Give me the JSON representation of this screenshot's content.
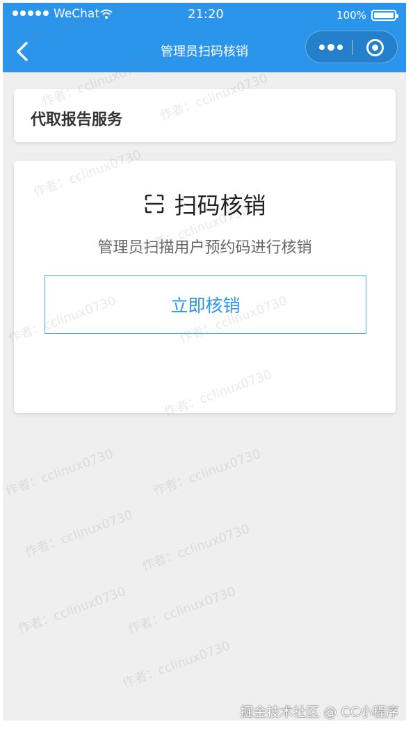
{
  "status_bar": {
    "carrier": "WeChat",
    "time": "21:20",
    "battery_text": "100%",
    "battery_level": 1.0
  },
  "nav": {
    "title": "管理员扫码核销",
    "back_icon": "chevron-left-icon",
    "menu_icon": "more-dots-icon",
    "close_icon": "target-ring-icon"
  },
  "service_card": {
    "title": "代取报告服务"
  },
  "scan_card": {
    "icon": "scan-frame-icon",
    "title": "扫码核销",
    "description": "管理员扫描用户预约码进行核销",
    "button_label": "立即核销"
  },
  "watermark": {
    "text": "作者：cclinux0730"
  },
  "footer": {
    "text": "掘金技术社区 @ CC小程序"
  },
  "colors": {
    "accent": "#2b95ec",
    "background": "#efefef"
  }
}
